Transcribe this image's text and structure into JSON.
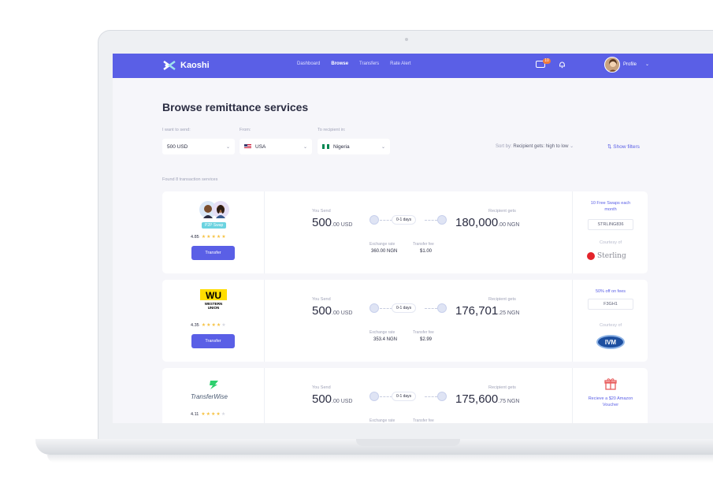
{
  "brand": {
    "name": "Kaoshi",
    "accent": "#5a5fe6"
  },
  "nav": {
    "links": [
      "Dashboard",
      "Browse",
      "Transfers",
      "Rate Alert"
    ],
    "active": "Browse",
    "mail_badge": "10",
    "profile_label": "Profile"
  },
  "page": {
    "title": "Browse remittance services"
  },
  "filters": {
    "send_label": "I want to send:",
    "send_value": "500 USD",
    "from_label": "From:",
    "from_value": "USA",
    "to_label": "To recipient in:",
    "to_value": "Nigeria",
    "sort_label": "Sort by:",
    "sort_value": "Recipient gets: high to low",
    "show_filters": "Show filters"
  },
  "found_text": "Found 8 transaction services",
  "cards": [
    {
      "provider": "P2P Swap",
      "tag": "P2P Swap",
      "rating": "4.85",
      "stars": 5,
      "button": "Transfer",
      "you_send_label": "You Send",
      "send_int": "500",
      "send_dec": ".00 USD",
      "duration": "0-1 days",
      "recipient_label": "Recipient gets",
      "recv_int": "180,000",
      "recv_dec": ".00 NGN",
      "rate_label": "Exchange rate",
      "rate_value": "360.00 NGN",
      "fee_label": "Transfer fee",
      "fee_value": "$1.00",
      "promo": "10 Free Swaps each month",
      "code": "STRLING836",
      "courtesy": "Courtesy of",
      "sponsor": "Sterling"
    },
    {
      "provider": "Western Union",
      "rating": "4.35",
      "stars": 4,
      "button": "Transfer",
      "you_send_label": "You Send",
      "send_int": "500",
      "send_dec": ".00 USD",
      "duration": "0-1 days",
      "recipient_label": "Recipient gets",
      "recv_int": "176,701",
      "recv_dec": ".25 NGN",
      "rate_label": "Exchange rate",
      "rate_value": "353.4 NGN",
      "fee_label": "Transfer fee",
      "fee_value": "$2.99",
      "promo": "50% off on fees",
      "code": "F3GH1",
      "courtesy": "Courtesy of",
      "sponsor": "IVM"
    },
    {
      "provider": "TransferWise",
      "rating": "4.11",
      "stars": 4,
      "button": "Transfer",
      "you_send_label": "You Send",
      "send_int": "500",
      "send_dec": ".00 USD",
      "duration": "0-1 days",
      "recipient_label": "Recipient gets",
      "recv_int": "175,600",
      "recv_dec": ".75 NGN",
      "rate_label": "Exchange rate",
      "fee_label": "Transfer fee",
      "promo": "Recieve a $20 Amazon Voucher"
    }
  ]
}
